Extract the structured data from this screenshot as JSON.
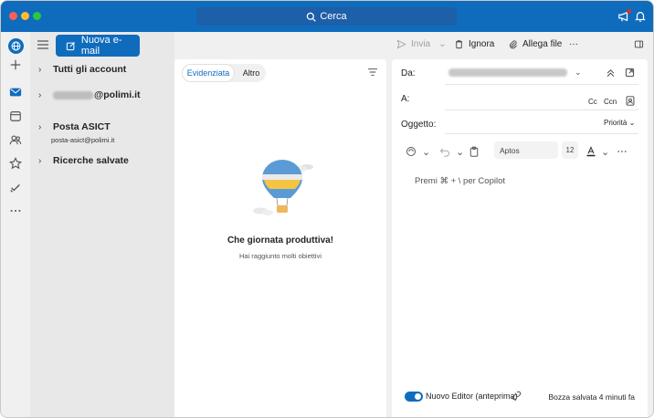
{
  "titlebar": {
    "search_label": "Cerca"
  },
  "rail": {
    "items": [
      "globe",
      "add",
      "mail",
      "calendar",
      "people",
      "favorites",
      "tasks",
      "more"
    ]
  },
  "folders": {
    "new_mail_label": "Nuova e-mail",
    "items": [
      {
        "label": "Tutti gli account",
        "sub": ""
      },
      {
        "label": "@polimi.it",
        "sub": ""
      },
      {
        "label": "Posta ASICT",
        "sub": "posta-asict@polimi.it"
      },
      {
        "label": "Ricerche salvate",
        "sub": ""
      }
    ]
  },
  "list": {
    "tab_focused": "Evidenziata",
    "tab_other": "Altro",
    "empty_title": "Che giornata produttiva!",
    "empty_subtitle": "Hai raggiunto molti obiettivi"
  },
  "toolbar": {
    "send_label": "Invia",
    "discard_label": "Ignora",
    "attach_label": "Allega file",
    "more_label": "···"
  },
  "compose": {
    "from_label": "Da:",
    "to_label": "A:",
    "subject_label": "Oggetto:",
    "cc_label": "Cc",
    "bcc_label": "Ccn",
    "priority_label": "Priorità",
    "font_name": "Aptos",
    "font_size": "12",
    "body_placeholder": "Premi ⌘ + \\ per Copilot",
    "editor_toggle_label": "Nuovo Editor (anteprima)",
    "draft_status": "Bozza salvata 4 minuti fa"
  },
  "colors": {
    "accent": "#0f6cbd",
    "titlebar": "#0f6cbd"
  }
}
